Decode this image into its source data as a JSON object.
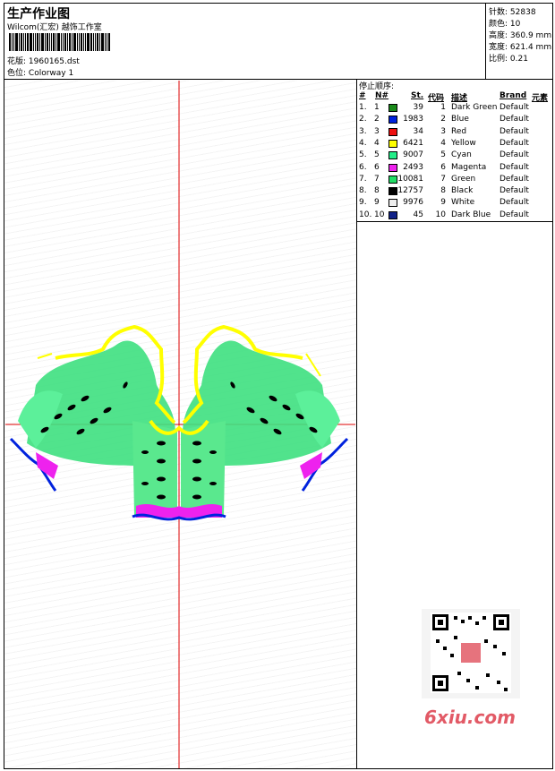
{
  "header": {
    "title": "生产作业图",
    "company": "Wilcom(汇宏) 越饰工作室",
    "file_label": "花版:",
    "file_name": "1960165.dst",
    "colorway_label": "色位:",
    "colorway": "Colorway 1"
  },
  "stats": [
    {
      "label": "针数:",
      "value": "52838"
    },
    {
      "label": "颜色:",
      "value": "10"
    },
    {
      "label": "高度:",
      "value": "360.9 mm"
    },
    {
      "label": "宽度:",
      "value": "621.4 mm"
    },
    {
      "label": "比例:",
      "value": "0.21"
    }
  ],
  "stop_sequence": {
    "title": "停止顺序:",
    "columns": [
      "#",
      "N#",
      "St.",
      "代码",
      "描述",
      "Brand",
      "元素"
    ],
    "rows": [
      {
        "idx": "1.",
        "n": "1",
        "color": "#1a8a1a",
        "st": "39",
        "code": "1",
        "desc": "Dark Green",
        "brand": "Default"
      },
      {
        "idx": "2.",
        "n": "2",
        "color": "#0022dd",
        "st": "1983",
        "code": "2",
        "desc": "Blue",
        "brand": "Default"
      },
      {
        "idx": "3.",
        "n": "3",
        "color": "#ee1111",
        "st": "34",
        "code": "3",
        "desc": "Red",
        "brand": "Default"
      },
      {
        "idx": "4.",
        "n": "4",
        "color": "#ffff00",
        "st": "6421",
        "code": "4",
        "desc": "Yellow",
        "brand": "Default"
      },
      {
        "idx": "5.",
        "n": "5",
        "color": "#22ee88",
        "st": "9007",
        "code": "5",
        "desc": "Cyan",
        "brand": "Default"
      },
      {
        "idx": "6.",
        "n": "6",
        "color": "#ee22ee",
        "st": "2493",
        "code": "6",
        "desc": "Magenta",
        "brand": "Default"
      },
      {
        "idx": "7.",
        "n": "7",
        "color": "#22dd66",
        "st": "10081",
        "code": "7",
        "desc": "Green",
        "brand": "Default"
      },
      {
        "idx": "8.",
        "n": "8",
        "color": "#000000",
        "st": "12757",
        "code": "8",
        "desc": "Black",
        "brand": "Default"
      },
      {
        "idx": "9.",
        "n": "9",
        "color": "#eeeeee",
        "st": "9976",
        "code": "9",
        "desc": "White",
        "brand": "Default"
      },
      {
        "idx": "10.",
        "n": "10",
        "color": "#112288",
        "st": "45",
        "code": "10",
        "desc": "Dark Blue",
        "brand": "Default"
      }
    ]
  },
  "watermark": "6xiu.com",
  "colors": {
    "crosshair": "#dd0000",
    "accent": "#e25a66"
  }
}
